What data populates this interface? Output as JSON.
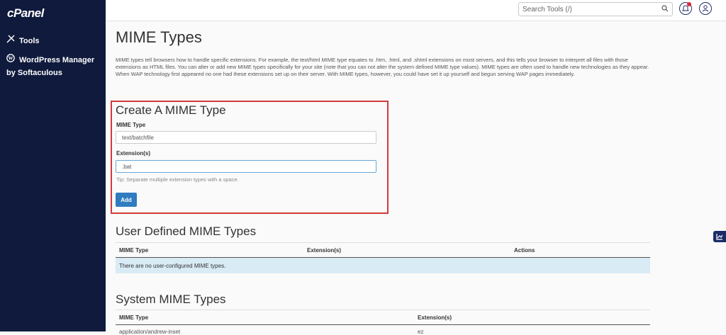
{
  "sidebar": {
    "logo": "cPanel",
    "items": [
      {
        "label": "Tools",
        "icon": "tools-icon"
      },
      {
        "label": "WordPress Manager by Softaculous",
        "icon": "wordpress-icon"
      }
    ]
  },
  "topbar": {
    "search_placeholder": "Search Tools (/)"
  },
  "page": {
    "title": "MIME Types",
    "description": "MIME types tell browsers how to handle specific extensions. For example, the text/html MIME type equates to .htm, .html, and .shtml extensions on most servers, and this tells your browser to interpret all files with those extensions as HTML files. You can alter or add new MIME types specifically for your site (note that you can not alter the system defined MIME type values). MIME types are often used to handle new technologies as they appear. When WAP technology first appeared no one had these extensions set up on their server. With MIME types, however, you could have set it up yourself and begun serving WAP pages immediately."
  },
  "create": {
    "title": "Create A MIME Type",
    "mime_label": "MIME Type",
    "mime_value": "text/batchfile",
    "ext_label": "Extension(s)",
    "ext_value": ".bat",
    "tip": "Tip: Separate multiple extension types with a space.",
    "add_label": "Add"
  },
  "user_defined": {
    "title": "User Defined MIME Types",
    "columns": [
      "MIME Type",
      "Extension(s)",
      "Actions"
    ],
    "empty": "There are no user-configured MIME types."
  },
  "system": {
    "title": "System MIME Types",
    "columns": [
      "MIME Type",
      "Extension(s)"
    ],
    "first_row": [
      "application/andrew-inset",
      "ez"
    ]
  },
  "colors": {
    "sidebar": "#0f1a3c",
    "primary_button": "#2f7cc1",
    "highlight_border": "#d23a3a",
    "empty_row": "#d9ebf5"
  }
}
